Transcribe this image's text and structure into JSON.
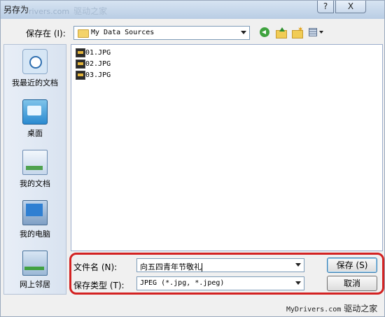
{
  "window": {
    "title": "另存为",
    "watermark_latin": "rivers.com",
    "watermark_han": "驱动之家",
    "help_label": "?",
    "close_label": "X"
  },
  "toolbar": {
    "savein_label": "保存在 (I):",
    "current_path": "My Data Sources",
    "back_icon": "back-arrow-icon",
    "up_icon": "up-folder-icon",
    "newfolder_icon": "new-folder-icon",
    "views_icon": "views-menu-icon"
  },
  "places": [
    {
      "label": "我最近的文档",
      "icon": "recent-documents-icon"
    },
    {
      "label": "桌面",
      "icon": "desktop-icon"
    },
    {
      "label": "我的文档",
      "icon": "my-documents-icon"
    },
    {
      "label": "我的电脑",
      "icon": "my-computer-icon"
    },
    {
      "label": "网上邻居",
      "icon": "network-places-icon"
    }
  ],
  "files": [
    {
      "name": "01.JPG"
    },
    {
      "name": "02.JPG"
    },
    {
      "name": "03.JPG"
    }
  ],
  "form": {
    "filename_label": "文件名 (N):",
    "filename_value": "向五四青年节敬礼",
    "filetype_label": "保存类型 (T):",
    "filetype_value": "JPEG (*.jpg, *.jpeg)",
    "save_label": "保存 (S)",
    "cancel_label": "取消"
  },
  "footer": {
    "brand_latin": "MyDrivers.com",
    "brand_han": "驱动之家"
  }
}
